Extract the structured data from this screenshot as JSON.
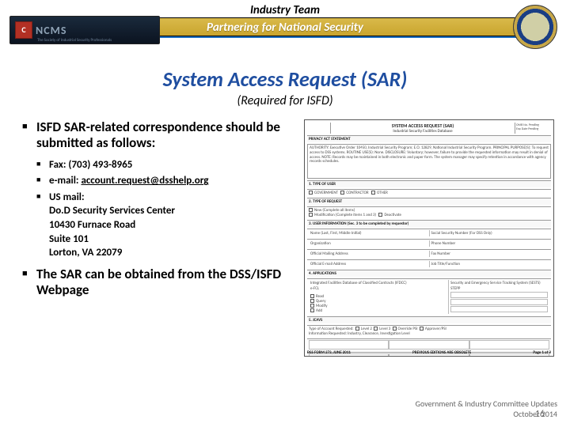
{
  "header": {
    "team": "Industry Team",
    "tagline": "Partnering for National Security",
    "logo_text": "NCMS",
    "logo_sub": "The Society of Industrial Security Professionals",
    "logo_glyph": "C"
  },
  "title": "System Access Request (SAR)",
  "subtitle": "(Required for ISFD)",
  "bullets": {
    "intro": "ISFD SAR-related correspondence should be submitted as follows:",
    "fax_label": "Fax:  (703) 493-8965",
    "email_label": "e-mail:",
    "email_addr": "account.request@dsshelp.org",
    "mail_label": "US mail:",
    "addr1": "Do.D Security Services Center",
    "addr2": "10430 Furnace Road",
    "addr3": "Suite 101",
    "addr4": "Lorton, VA 22079",
    "obtain": "The SAR can be obtained from the DSS/ISFD Webpage"
  },
  "form": {
    "title": "SYSTEM ACCESS REQUEST (SAR)",
    "subtitle": "Industrial Security Facilities Database",
    "privacy_hdr": "PRIVACY ACT STATEMENT",
    "privacy_body": "AUTHORITY: Executive Order 10450, Industrial Security Program; E.O. 12829, National Industrial Security Program. PRINCIPAL PURPOSE(S): To request access to DSS systems. ROUTINE USE(S): None. DISCLOSURE: Voluntary; however, failure to provide the requested information may result in denial of access. NOTE: Records may be maintained in both electronic and paper form. The system manager may specify retention in accordance with agency records schedules.",
    "sec1": "1.   TYPE OF USER",
    "sec1_a": "GOVERNMENT",
    "sec1_b": "CONTRACTOR",
    "sec1_c": "OTHER",
    "sec2": "2.   TYPE OF REQUEST",
    "sec2_a": "New (Complete all items)",
    "sec2_b": "Modification (Complete items 1 and 3)",
    "sec2_c": "Deactivate",
    "sec3": "3.   USER INFORMATION (Sec. 3 to be completed by requestor)",
    "lbl_name": "Name (Last, First, Middle Initial)",
    "lbl_ssn": "Social Security Number (For DSS Only)",
    "lbl_org": "Organization",
    "lbl_phone": "Phone Number",
    "lbl_addr": "Official Mailing Address",
    "lbl_fax": "Fax Number",
    "lbl_email": "Official E-mail Address",
    "lbl_title": "Job Title/Function",
    "sec4": "4.   APPLICATIONS",
    "app1": "Integrated Facilities Database of Classified Contracts (IFDCC)",
    "app2": "e-FCL",
    "app_r1": "Security and Emergency Service Tracking System (SESTS)",
    "app_r2": "STEPP",
    "cb1": "Read",
    "cb2": "Query",
    "cb3": "Modify",
    "cb4": "Add",
    "sec5": "5.   JCAVS",
    "jc1": "Type of Account Requested:",
    "jc2": "Level 2",
    "jc3": "Level 3",
    "jc4": "Override PSI",
    "jc5": "Approver/PSI",
    "jc6": "Information Requested: Industry, Clearance, Investigation Level",
    "foot_l": "DSS FORM 273, JUNE 2011",
    "foot_c": "PREVIOUS EDITIONS ARE OBSOLETE",
    "foot_r": "Page 1 of 2"
  },
  "footer": {
    "line1": "Government & Industry Committee Updates",
    "line2": "October 2014",
    "page": "16"
  }
}
